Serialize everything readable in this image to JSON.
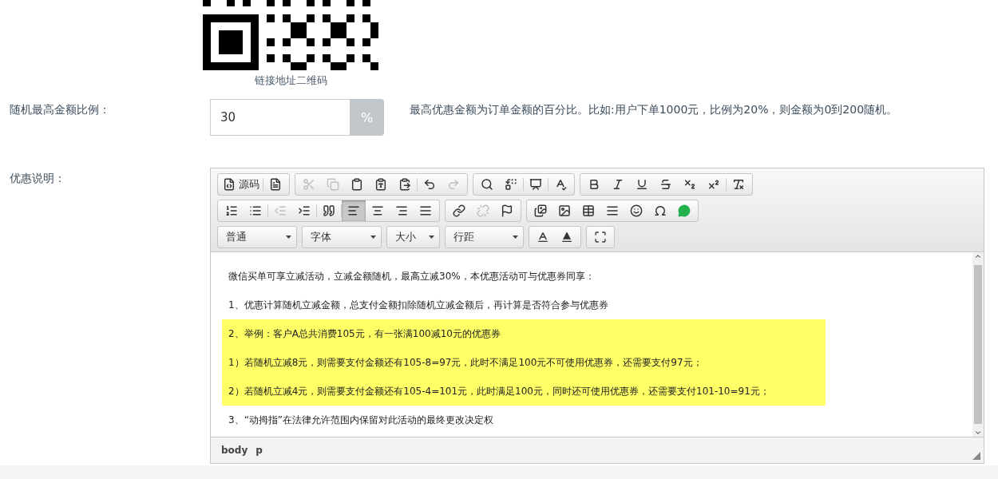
{
  "qr": {
    "caption": "链接地址二维码"
  },
  "ratio": {
    "label": "随机最高金额比例：",
    "value": "30",
    "addon": "%",
    "help": "最高优惠金额为订单金额的百分比。比如:用户下单1000元，比例为20%，则金额为0到200随机。"
  },
  "description": {
    "label": "优惠说明：",
    "toolbar": [
      [
        {
          "label": "源码",
          "items": [
            {
              "disabled": false
            },
            {
              "disabled": false
            }
          ]
        },
        {
          "items": [
            {
              "disabled": true
            },
            {
              "disabled": true
            },
            {
              "disabled": false
            },
            {
              "disabled": false
            },
            {
              "disabled": false
            },
            {
              "disabled": false
            },
            {
              "disabled": true
            }
          ]
        },
        {
          "items": [
            {
              "disabled": false
            },
            {
              "disabled": false
            },
            {
              "disabled": false
            },
            {
              "disabled": false
            }
          ]
        },
        {
          "items": [
            {
              "disabled": false
            },
            {
              "disabled": false
            },
            {
              "disabled": false
            },
            {
              "disabled": false
            },
            {
              "disabled": false
            },
            {
              "disabled": false
            },
            {
              "disabled": false
            }
          ]
        }
      ],
      [
        {
          "items": [
            {
              "disabled": false,
              "selected": false
            },
            {
              "disabled": false,
              "selected": false
            },
            {
              "disabled": true,
              "selected": false
            },
            {
              "disabled": false,
              "selected": false
            },
            {
              "disabled": false,
              "selected": false
            },
            {
              "disabled": false,
              "selected": true
            },
            {
              "disabled": false,
              "selected": false
            },
            {
              "disabled": false,
              "selected": false
            },
            {
              "disabled": false,
              "selected": false
            }
          ]
        },
        {
          "items": [
            {
              "disabled": false
            },
            {
              "disabled": true
            },
            {
              "disabled": false
            }
          ]
        },
        {
          "items": [
            {
              "disabled": false
            },
            {
              "disabled": false
            },
            {
              "disabled": false
            },
            {
              "disabled": false
            },
            {
              "disabled": false
            },
            {
              "disabled": false
            },
            {
              "disabled": false
            }
          ]
        }
      ]
    ],
    "combos": [
      "普通",
      "字体",
      "大小",
      "行距"
    ],
    "paragraphs": [
      {
        "text": "微信买单可享立减活动，立减金额随机，最高立减30%，本优惠活动可与优惠券同享：",
        "highlighted": false
      },
      {
        "text": "1、优惠计算随机立减金额，总支付金额扣除随机立减金额后，再计算是否符合参与优惠券",
        "highlighted": false
      },
      {
        "text": "2、举例：客户A总共消费105元，有一张满100减10元的优惠券",
        "highlighted": true
      },
      {
        "text": "1）若随机立减8元，则需要支付金额还有105-8=97元，此时不满足100元不可使用优惠券，还需要支付97元；",
        "highlighted": true
      },
      {
        "text": "2）若随机立减4元，则需要支付金额还有105-4=101元，此时满足100元，同时还可使用优惠券，还需要支付101-10=91元；",
        "highlighted": true
      },
      {
        "text": "3、“动拇指”在法律允许范围内保留对此活动的最终更改决定权",
        "highlighted": false
      }
    ],
    "path": [
      "body",
      "p"
    ]
  }
}
